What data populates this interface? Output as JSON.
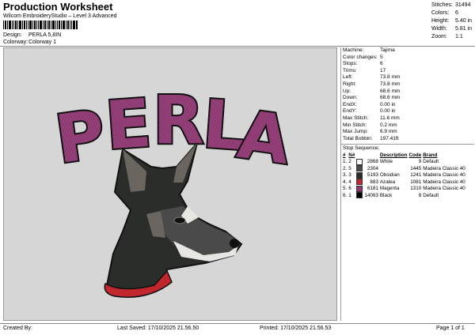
{
  "header": {
    "title": "Production Worksheet",
    "subtitle": "Wilcom EmbroideryStudio – Level 3 Advanced",
    "design_label": "Design:",
    "design_value": "PERLA 5,8IN",
    "colorway_label": "Colorway:",
    "colorway_value": "Colorway 1"
  },
  "summary": [
    {
      "label": "Stitches:",
      "value": "31494"
    },
    {
      "label": "Colors:",
      "value": "6"
    },
    {
      "label": "Height:",
      "value": "5.40 in"
    },
    {
      "label": "Width:",
      "value": "5.81 in"
    },
    {
      "label": "Zoom:",
      "value": "1:1"
    }
  ],
  "design_preview": {
    "text": "PERLA",
    "colors": {
      "fill": "#8e3a72",
      "outline": "#111111",
      "canvas": "#d6d6d6",
      "collar": "#c1272d"
    }
  },
  "stats": [
    {
      "label": "Machine:",
      "value": "Tajima"
    },
    {
      "label": "Color changes:",
      "value": "5"
    },
    {
      "label": "Stops:",
      "value": "6"
    },
    {
      "label": "Trims:",
      "value": "17"
    },
    {
      "label": "Left:",
      "value": "73.8 mm"
    },
    {
      "label": "Right:",
      "value": "73.8 mm"
    },
    {
      "label": "Up:",
      "value": "68.6 mm"
    },
    {
      "label": "Down:",
      "value": "68.6 mm"
    },
    {
      "label": "EndX:",
      "value": "0.00 in"
    },
    {
      "label": "EndY:",
      "value": "0.00 in"
    },
    {
      "label": "Max Stitch:",
      "value": "11.6 mm"
    },
    {
      "label": "Min Stitch:",
      "value": "0.2 mm"
    },
    {
      "label": "Max Jump:",
      "value": "6.9 mm"
    },
    {
      "label": "Total Bobbin:",
      "value": "197.41ft"
    }
  ],
  "stop_sequence": {
    "title": "Stop Sequence:",
    "headers": [
      "#",
      "N#",
      "",
      "",
      "Description",
      "Code",
      "Brand"
    ],
    "rows": [
      {
        "num": "1.",
        "n": "2",
        "color": "#ffffff",
        "stitches": "2868",
        "desc": "White",
        "code": "9",
        "brand": "Default"
      },
      {
        "num": "2.",
        "n": "5",
        "color": "#4a4a4a",
        "stitches": "2304",
        "desc": "",
        "code": "1445",
        "brand": "Madeira Classic 40"
      },
      {
        "num": "3.",
        "n": "3",
        "color": "#2a2d2a",
        "stitches": "5193",
        "desc": "Obsidian",
        "code": "1241",
        "brand": "Madeira Classic 40"
      },
      {
        "num": "4.",
        "n": "4",
        "color": "#c1272d",
        "stitches": "883",
        "desc": "Azalea",
        "code": "1081",
        "brand": "Madeira Classic 40"
      },
      {
        "num": "5.",
        "n": "6",
        "color": "#8e3a72",
        "stitches": "6181",
        "desc": "Magenta",
        "code": "1310",
        "brand": "Madeira Classic 40"
      },
      {
        "num": "6.",
        "n": "1",
        "color": "#000000",
        "stitches": "14063",
        "desc": "Black",
        "code": "8",
        "brand": "Default"
      }
    ]
  },
  "footer": {
    "created": "Created By:",
    "saved": "Last Saved: 17/10/2025 21.56.50",
    "printed": "Printed: 17/10/2025 21.56.53",
    "page": "Page 1 of 1"
  }
}
